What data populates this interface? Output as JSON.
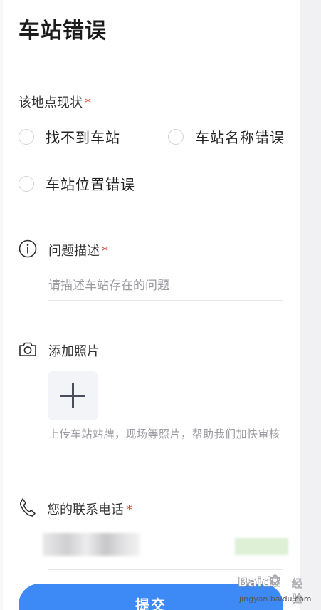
{
  "header": {
    "title": "车站错误"
  },
  "status": {
    "label": "该地点现状",
    "required_mark": "*",
    "options": [
      {
        "label": "找不到车站"
      },
      {
        "label": "车站名称错误"
      },
      {
        "label": "车站位置错误"
      }
    ]
  },
  "description": {
    "label": "问题描述",
    "required_mark": "*",
    "icon": "info-icon",
    "placeholder": "请描述车站存在的问题",
    "value": ""
  },
  "photo": {
    "label": "添加照片",
    "icon": "camera-icon",
    "upload_icon": "plus-icon",
    "hint": "上传车站站牌，现场等照片，帮助我们加快审核"
  },
  "phone": {
    "label": "您的联系电话",
    "required_mark": "*",
    "icon": "phone-icon"
  },
  "submit": {
    "label": "提交"
  },
  "watermark": {
    "logo": "Baidu",
    "suffix": "经验",
    "url": "jingyan.baidu.com"
  },
  "colors": {
    "accent": "#3d8af7",
    "required": "#e8453c",
    "placeholder": "#9a9aa0",
    "side_strip": "#f1f1f3"
  }
}
